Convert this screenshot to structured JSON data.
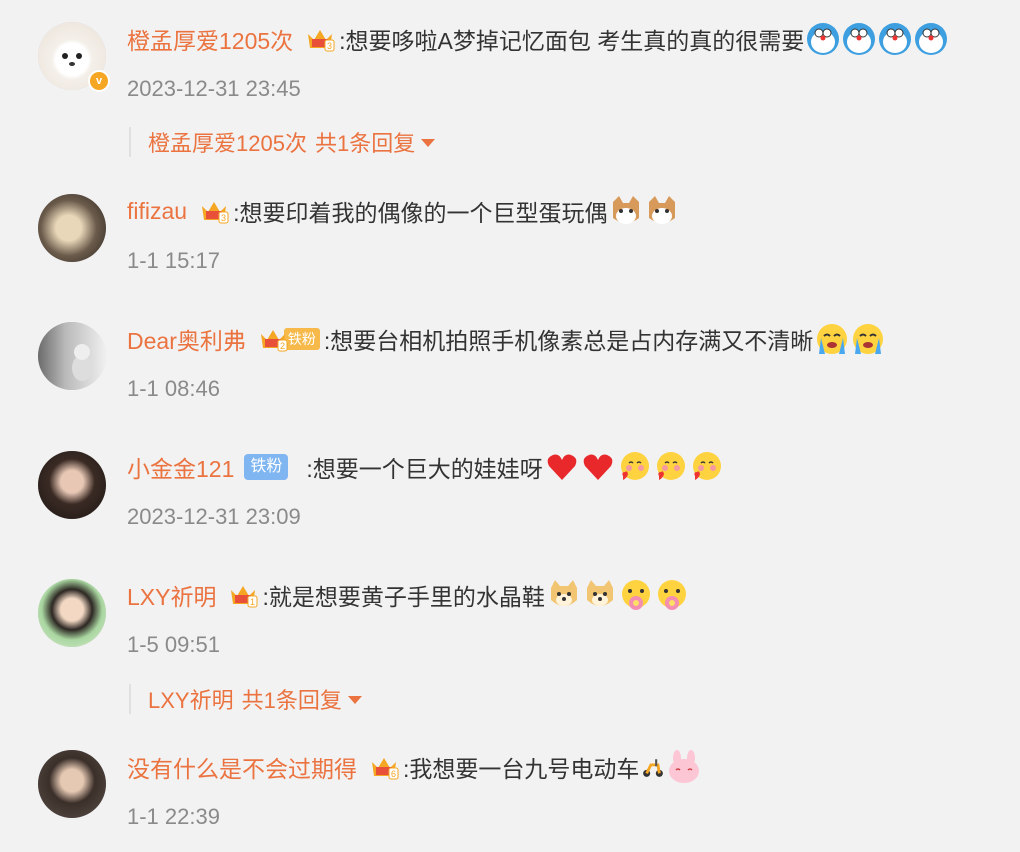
{
  "comments": [
    {
      "username": "橙孟厚爱1205次",
      "text": ":想要哆啦A梦掉记忆面包 考生真的真的很需要",
      "time": "2023-12-31 23:45",
      "crown_level": "3",
      "emojis": [
        "doraemon-emoji",
        "doraemon-emoji",
        "doraemon-emoji",
        "doraemon-emoji"
      ],
      "reply": {
        "user": "橙孟厚爱1205次",
        "label": "共1条回复"
      }
    },
    {
      "username": "fifizau",
      "text": ":想要印着我的偶像的一个巨型蛋玩偶",
      "time": "1-1 15:17",
      "crown_level": "3",
      "emojis": [
        "cat-emoji",
        "cat-emoji"
      ]
    },
    {
      "username": "Dear奥利弗",
      "text": ":想要台相机拍照手机像素总是占内存满又不清晰",
      "time": "1-1 08:46",
      "crown_level": "2",
      "fan_badge": "铁粉",
      "emojis": [
        "cry-emoji",
        "cry-emoji"
      ]
    },
    {
      "username": "小金金121",
      "text": ":想要一个巨大的娃娃呀",
      "time": "2023-12-31 23:09",
      "fan_badge": "铁粉",
      "emojis": [
        "heart-emoji",
        "heart-emoji",
        "blush-emoji",
        "blush-emoji",
        "blush-emoji"
      ]
    },
    {
      "username": "LXY祈明",
      "text": ":就是想要黄子手里的水晶鞋",
      "time": "1-5 09:51",
      "crown_level": "1",
      "emojis": [
        "doge-emoji",
        "doge-emoji",
        "flower-emoji",
        "flower-emoji"
      ],
      "reply": {
        "user": "LXY祈明",
        "label": "共1条回复"
      }
    },
    {
      "username": "没有什么是不会过期得",
      "text": ":我想要一台九号电动车",
      "time": "1-1 22:39",
      "crown_level": "6",
      "emojis": [
        "scooter-emoji",
        "bunny-emoji"
      ]
    }
  ],
  "colors": {
    "username": "#eb7340",
    "time": "#8a8a8a",
    "text": "#333333",
    "background": "#f2f2f2"
  }
}
